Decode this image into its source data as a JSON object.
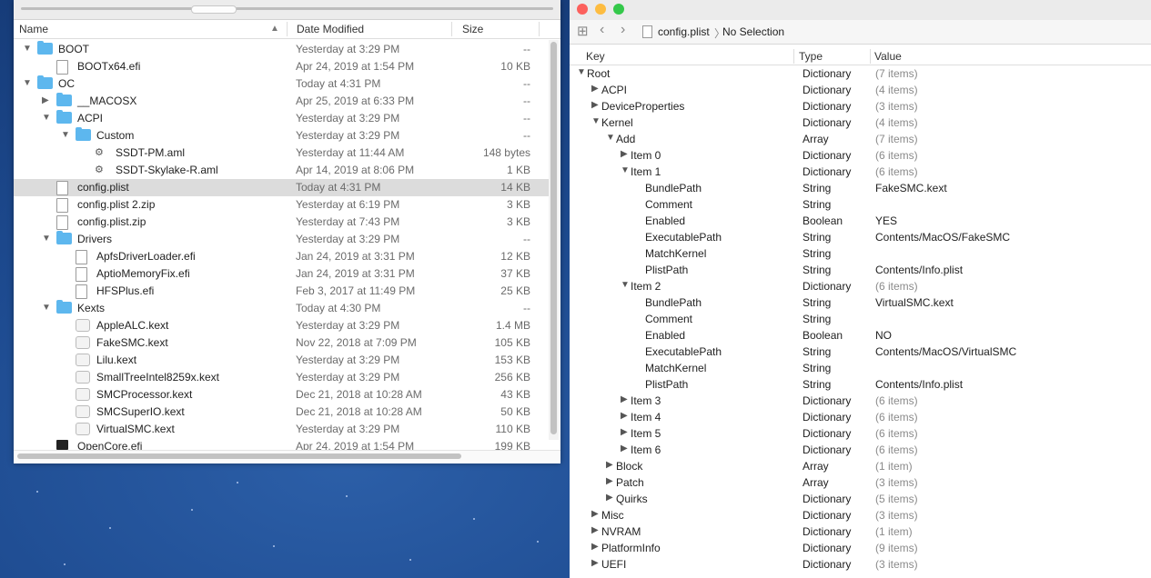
{
  "finder": {
    "columns": {
      "name": "Name",
      "date": "Date Modified",
      "size": "Size"
    },
    "rows": [
      {
        "depth": 0,
        "tri": "down",
        "icon": "folder",
        "name": "BOOT",
        "date": "Yesterday at 3:29 PM",
        "size": "--"
      },
      {
        "depth": 1,
        "tri": "",
        "icon": "file",
        "name": "BOOTx64.efi",
        "date": "Apr 24, 2019 at 1:54 PM",
        "size": "10 KB"
      },
      {
        "depth": 0,
        "tri": "down",
        "icon": "folder",
        "name": "OC",
        "date": "Today at 4:31 PM",
        "size": "--"
      },
      {
        "depth": 1,
        "tri": "right",
        "icon": "folder",
        "name": "__MACOSX",
        "date": "Apr 25, 2019 at 6:33 PM",
        "size": "--"
      },
      {
        "depth": 1,
        "tri": "down",
        "icon": "folder",
        "name": "ACPI",
        "date": "Yesterday at 3:29 PM",
        "size": "--"
      },
      {
        "depth": 2,
        "tri": "down",
        "icon": "folder",
        "name": "Custom",
        "date": "Yesterday at 3:29 PM",
        "size": "--"
      },
      {
        "depth": 3,
        "tri": "",
        "icon": "aml",
        "name": "SSDT-PM.aml",
        "date": "Yesterday at 11:44 AM",
        "size": "148 bytes"
      },
      {
        "depth": 3,
        "tri": "",
        "icon": "aml",
        "name": "SSDT-Skylake-R.aml",
        "date": "Apr 14, 2019 at 8:06 PM",
        "size": "1 KB"
      },
      {
        "depth": 1,
        "tri": "",
        "icon": "file",
        "name": "config.plist",
        "date": "Today at 4:31 PM",
        "size": "14 KB",
        "selected": true
      },
      {
        "depth": 1,
        "tri": "",
        "icon": "file",
        "name": "config.plist 2.zip",
        "date": "Yesterday at 6:19 PM",
        "size": "3 KB"
      },
      {
        "depth": 1,
        "tri": "",
        "icon": "file",
        "name": "config.plist.zip",
        "date": "Yesterday at 7:43 PM",
        "size": "3 KB"
      },
      {
        "depth": 1,
        "tri": "down",
        "icon": "folder",
        "name": "Drivers",
        "date": "Yesterday at 3:29 PM",
        "size": "--"
      },
      {
        "depth": 2,
        "tri": "",
        "icon": "file",
        "name": "ApfsDriverLoader.efi",
        "date": "Jan 24, 2019 at 3:31 PM",
        "size": "12 KB"
      },
      {
        "depth": 2,
        "tri": "",
        "icon": "file",
        "name": "AptioMemoryFix.efi",
        "date": "Jan 24, 2019 at 3:31 PM",
        "size": "37 KB"
      },
      {
        "depth": 2,
        "tri": "",
        "icon": "file",
        "name": "HFSPlus.efi",
        "date": "Feb 3, 2017 at 11:49 PM",
        "size": "25 KB"
      },
      {
        "depth": 1,
        "tri": "down",
        "icon": "folder",
        "name": "Kexts",
        "date": "Today at 4:30 PM",
        "size": "--"
      },
      {
        "depth": 2,
        "tri": "",
        "icon": "kext",
        "name": "AppleALC.kext",
        "date": "Yesterday at 3:29 PM",
        "size": "1.4 MB"
      },
      {
        "depth": 2,
        "tri": "",
        "icon": "kext",
        "name": "FakeSMC.kext",
        "date": "Nov 22, 2018 at 7:09 PM",
        "size": "105 KB"
      },
      {
        "depth": 2,
        "tri": "",
        "icon": "kext",
        "name": "Lilu.kext",
        "date": "Yesterday at 3:29 PM",
        "size": "153 KB"
      },
      {
        "depth": 2,
        "tri": "",
        "icon": "kext",
        "name": "SmallTreeIntel8259x.kext",
        "date": "Yesterday at 3:29 PM",
        "size": "256 KB"
      },
      {
        "depth": 2,
        "tri": "",
        "icon": "kext",
        "name": "SMCProcessor.kext",
        "date": "Dec 21, 2018 at 10:28 AM",
        "size": "43 KB"
      },
      {
        "depth": 2,
        "tri": "",
        "icon": "kext",
        "name": "SMCSuperIO.kext",
        "date": "Dec 21, 2018 at 10:28 AM",
        "size": "50 KB"
      },
      {
        "depth": 2,
        "tri": "",
        "icon": "kext",
        "name": "VirtualSMC.kext",
        "date": "Yesterday at 3:29 PM",
        "size": "110 KB"
      },
      {
        "depth": 1,
        "tri": "",
        "icon": "efi",
        "name": "OpenCore.efi",
        "date": "Apr 24, 2019 at 1:54 PM",
        "size": "199 KB"
      }
    ]
  },
  "plist": {
    "breadcrumb": {
      "file": "config.plist",
      "selection": "No Selection"
    },
    "columns": {
      "key": "Key",
      "type": "Type",
      "value": "Value"
    },
    "rows": [
      {
        "depth": 0,
        "tri": "down",
        "key": "Root",
        "type": "Dictionary",
        "value": "(7 items)",
        "muted": true
      },
      {
        "depth": 1,
        "tri": "right",
        "key": "ACPI",
        "type": "Dictionary",
        "value": "(4 items)",
        "muted": true
      },
      {
        "depth": 1,
        "tri": "right",
        "key": "DeviceProperties",
        "type": "Dictionary",
        "value": "(3 items)",
        "muted": true
      },
      {
        "depth": 1,
        "tri": "down",
        "key": "Kernel",
        "type": "Dictionary",
        "value": "(4 items)",
        "muted": true
      },
      {
        "depth": 2,
        "tri": "down",
        "key": "Add",
        "type": "Array",
        "value": "(7 items)",
        "muted": true
      },
      {
        "depth": 3,
        "tri": "right",
        "key": "Item 0",
        "type": "Dictionary",
        "value": "(6 items)",
        "muted": true
      },
      {
        "depth": 3,
        "tri": "down",
        "key": "Item 1",
        "type": "Dictionary",
        "value": "(6 items)",
        "muted": true
      },
      {
        "depth": 4,
        "tri": "",
        "key": "BundlePath",
        "type": "String",
        "value": "FakeSMC.kext"
      },
      {
        "depth": 4,
        "tri": "",
        "key": "Comment",
        "type": "String",
        "value": ""
      },
      {
        "depth": 4,
        "tri": "",
        "key": "Enabled",
        "type": "Boolean",
        "value": "YES"
      },
      {
        "depth": 4,
        "tri": "",
        "key": "ExecutablePath",
        "type": "String",
        "value": "Contents/MacOS/FakeSMC"
      },
      {
        "depth": 4,
        "tri": "",
        "key": "MatchKernel",
        "type": "String",
        "value": ""
      },
      {
        "depth": 4,
        "tri": "",
        "key": "PlistPath",
        "type": "String",
        "value": "Contents/Info.plist"
      },
      {
        "depth": 3,
        "tri": "down",
        "key": "Item 2",
        "type": "Dictionary",
        "value": "(6 items)",
        "muted": true
      },
      {
        "depth": 4,
        "tri": "",
        "key": "BundlePath",
        "type": "String",
        "value": "VirtualSMC.kext"
      },
      {
        "depth": 4,
        "tri": "",
        "key": "Comment",
        "type": "String",
        "value": ""
      },
      {
        "depth": 4,
        "tri": "",
        "key": "Enabled",
        "type": "Boolean",
        "value": "NO"
      },
      {
        "depth": 4,
        "tri": "",
        "key": "ExecutablePath",
        "type": "String",
        "value": "Contents/MacOS/VirtualSMC"
      },
      {
        "depth": 4,
        "tri": "",
        "key": "MatchKernel",
        "type": "String",
        "value": ""
      },
      {
        "depth": 4,
        "tri": "",
        "key": "PlistPath",
        "type": "String",
        "value": "Contents/Info.plist"
      },
      {
        "depth": 3,
        "tri": "right",
        "key": "Item 3",
        "type": "Dictionary",
        "value": "(6 items)",
        "muted": true
      },
      {
        "depth": 3,
        "tri": "right",
        "key": "Item 4",
        "type": "Dictionary",
        "value": "(6 items)",
        "muted": true
      },
      {
        "depth": 3,
        "tri": "right",
        "key": "Item 5",
        "type": "Dictionary",
        "value": "(6 items)",
        "muted": true
      },
      {
        "depth": 3,
        "tri": "right",
        "key": "Item 6",
        "type": "Dictionary",
        "value": "(6 items)",
        "muted": true
      },
      {
        "depth": 2,
        "tri": "right",
        "key": "Block",
        "type": "Array",
        "value": "(1 item)",
        "muted": true
      },
      {
        "depth": 2,
        "tri": "right",
        "key": "Patch",
        "type": "Array",
        "value": "(3 items)",
        "muted": true
      },
      {
        "depth": 2,
        "tri": "right",
        "key": "Quirks",
        "type": "Dictionary",
        "value": "(5 items)",
        "muted": true
      },
      {
        "depth": 1,
        "tri": "right",
        "key": "Misc",
        "type": "Dictionary",
        "value": "(3 items)",
        "muted": true
      },
      {
        "depth": 1,
        "tri": "right",
        "key": "NVRAM",
        "type": "Dictionary",
        "value": "(1 item)",
        "muted": true
      },
      {
        "depth": 1,
        "tri": "right",
        "key": "PlatformInfo",
        "type": "Dictionary",
        "value": "(9 items)",
        "muted": true
      },
      {
        "depth": 1,
        "tri": "right",
        "key": "UEFI",
        "type": "Dictionary",
        "value": "(3 items)",
        "muted": true
      }
    ]
  },
  "colors": {
    "close": "#fc605c",
    "minimize": "#fdbc40",
    "zoom": "#34c84a",
    "folder": "#5db7ee",
    "selection": "#dcdcdc"
  }
}
